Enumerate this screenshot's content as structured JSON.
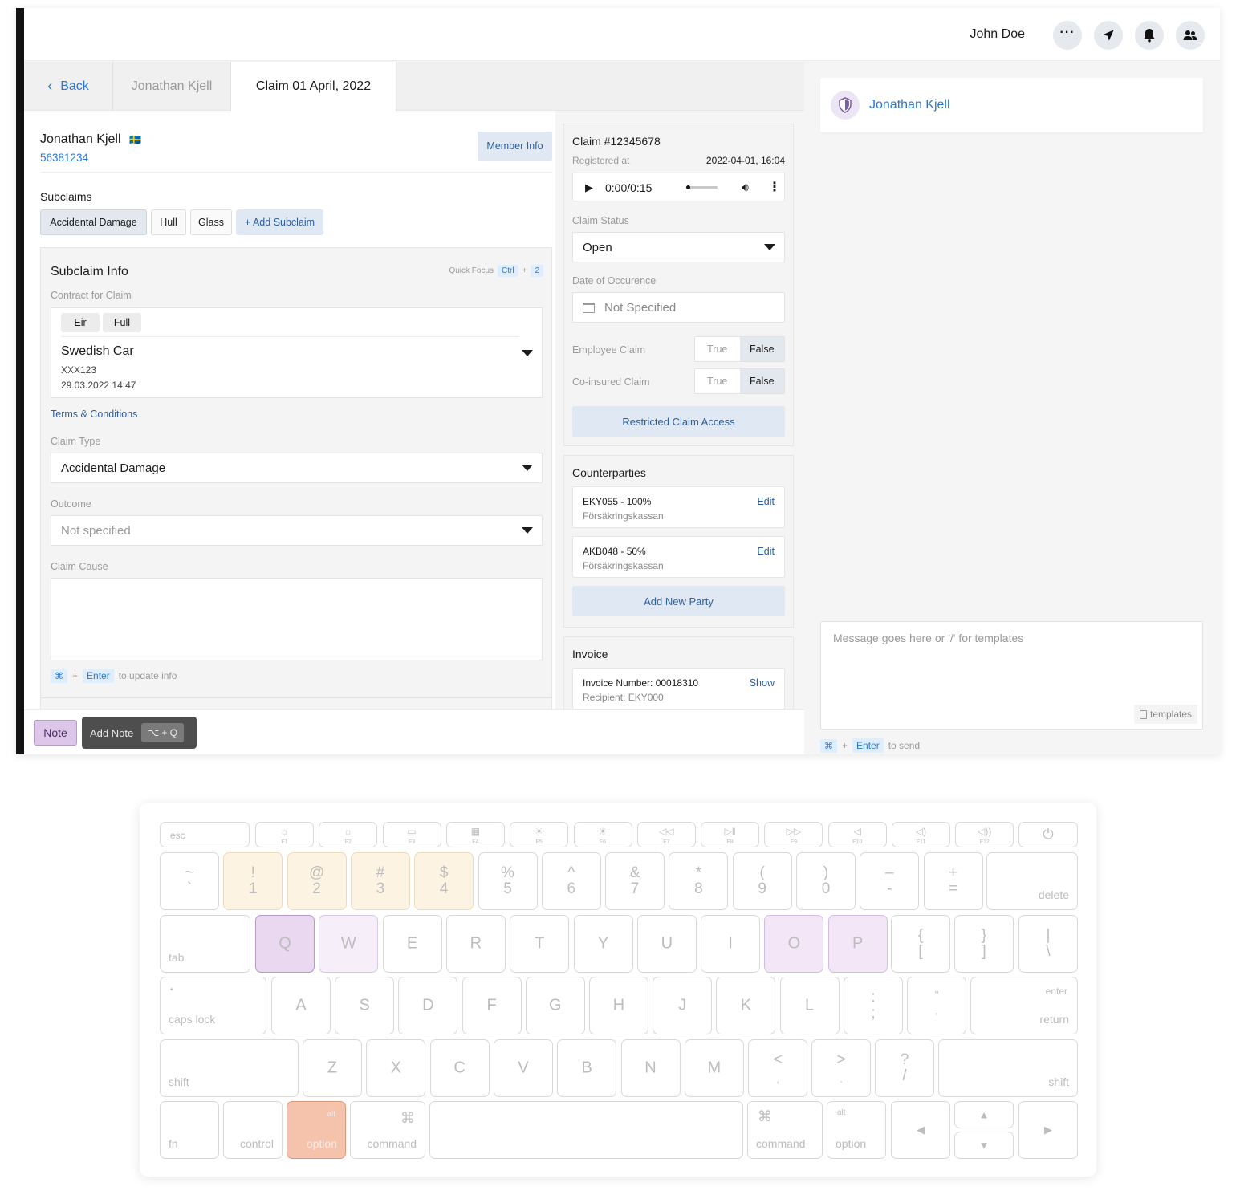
{
  "app": {
    "user_name": "John Doe",
    "tabs": {
      "back": "Back",
      "person": "Jonathan Kjell",
      "claim": "Claim 01 April, 2022"
    }
  },
  "member": {
    "name": "Jonathan Kjell",
    "flag": "🇸🇪",
    "number": "56381234",
    "member_info_button": "Member Info"
  },
  "subclaims": {
    "title": "Subclaims",
    "items": [
      "Accidental Damage",
      "Hull",
      "Glass"
    ],
    "add_button": "+ Add Subclaim"
  },
  "subclaim_info": {
    "title": "Subclaim Info",
    "quick_focus_label": "Quick Focus",
    "quick_focus_key1": "Ctrl",
    "quick_focus_plus": "+",
    "quick_focus_key2": "2",
    "contract_label": "Contract for Claim",
    "contract_tags": [
      "Eir",
      "Full"
    ],
    "contract_name": "Swedish Car",
    "contract_reg": "XXX123",
    "contract_date": "29.03.2022 14:47",
    "terms_link": "Terms & Conditions",
    "claim_type_label": "Claim Type",
    "claim_type_value": "Accidental Damage",
    "outcome_label": "Outcome",
    "outcome_placeholder": "Not specified",
    "claim_cause_label": "Claim Cause",
    "update_hint_key1": "⌘",
    "update_hint_plus": "+",
    "update_hint_key2": "Enter",
    "update_hint_text": "to update info"
  },
  "claim": {
    "number": "Claim #12345678",
    "registered_label": "Registered at",
    "registered_value": "2022-04-01, 16:04",
    "audio_time": "0:00/0:15",
    "audio_progress": 0.0,
    "status_label": "Claim Status",
    "status_value": "Open",
    "date_label": "Date of Occurence",
    "date_placeholder": "Not Specified",
    "employee_label": "Employee Claim",
    "coinsured_label": "Co-insured Claim",
    "toggle_true": "True",
    "toggle_false": "False",
    "restricted_button": "Restricted Claim Access"
  },
  "counterparties": {
    "title": "Counterparties",
    "items": [
      {
        "code": "EKY055 - 100%",
        "org": "Försäkringskassan",
        "action": "Edit"
      },
      {
        "code": "AKB048 - 50%",
        "org": "Försäkringskassan",
        "action": "Edit"
      }
    ],
    "add_button": "Add New Party"
  },
  "invoice": {
    "title": "Invoice",
    "number": "Invoice Number: 00018310",
    "recipient": "Recipient: EKY000",
    "action": "Show"
  },
  "bottom": {
    "note_button": "Note",
    "add_note_label": "Add Note",
    "add_note_shortcut": "⌥ + Q"
  },
  "chat": {
    "contact_name": "Jonathan Kjell",
    "message_placeholder": "Message goes here or '/' for templates",
    "templates_button": "templates",
    "send_key1": "⌘",
    "send_plus": "+",
    "send_key2": "Enter",
    "send_text": "to send"
  },
  "keyboard": {
    "esc": "esc",
    "fn_labels": [
      "F1",
      "F2",
      "F3",
      "F4",
      "F5",
      "F6",
      "F7",
      "F8",
      "F9",
      "F10",
      "F11",
      "F12"
    ],
    "fn_icons": [
      "☼",
      "☼",
      "▭",
      "▦",
      "☀",
      "☀",
      "◁◁",
      "▷‖",
      "▷▷",
      "◁",
      "◁)",
      "◁))"
    ],
    "power": "⏻",
    "num_tops": [
      "~",
      "!",
      "@",
      "#",
      "$",
      "%",
      "^",
      "&",
      "*",
      "(",
      ")",
      "–",
      "+"
    ],
    "num_bottoms": [
      "`",
      "1",
      "2",
      "3",
      "4",
      "5",
      "6",
      "7",
      "8",
      "9",
      "0",
      "-",
      "="
    ],
    "delete": "delete",
    "tab": "tab",
    "row_q": [
      "Q",
      "W",
      "E",
      "R",
      "T",
      "Y",
      "U",
      "I",
      "O",
      "P"
    ],
    "bracket_open_top": "{",
    "bracket_open_bottom": "[",
    "bracket_close_top": "}",
    "bracket_close_bottom": "]",
    "pipe_top": "|",
    "pipe_bottom": "\\",
    "caps_dot": "•",
    "caps_lock": "caps lock",
    "row_a": [
      "A",
      "S",
      "D",
      "F",
      "G",
      "H",
      "J",
      "K",
      "L"
    ],
    "semicolon_top": ":",
    "semicolon_bottom": ";",
    "quote_top": "\"",
    "quote_bottom": "'",
    "enter": "enter",
    "return": "return",
    "shift": "shift",
    "row_z": [
      "Z",
      "X",
      "C",
      "V",
      "B",
      "N",
      "M"
    ],
    "comma_top": "<",
    "comma_bottom": ",",
    "period_top": ">",
    "period_bottom": ".",
    "slash_top": "?",
    "slash_bottom": "/",
    "fn": "fn",
    "control": "control",
    "alt": "alt",
    "option": "option",
    "cmd_symbol": "⌘",
    "command": "command",
    "arrow_left": "◀",
    "arrow_up": "▲",
    "arrow_down": "▼",
    "arrow_right": "▶"
  }
}
